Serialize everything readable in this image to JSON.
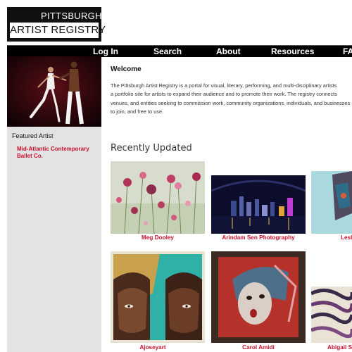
{
  "logo": {
    "line1": "PITTSBURGH",
    "line2": "ARTIST REGISTRY"
  },
  "nav": [
    {
      "label": "Log In"
    },
    {
      "label": "Search"
    },
    {
      "label": "About"
    },
    {
      "label": "Resources"
    },
    {
      "label": "FAQ"
    }
  ],
  "sidebar": {
    "featured_label": "Featured Artist",
    "featured_artist": "Mid-Atlantic Contemporary Ballet Co."
  },
  "welcome": {
    "title": "Welcome",
    "lines": [
      "The Pittsburgh Artist Registry is a portal for visual, literary, performing, and multi-disciplinary artists",
      "a portfolio site for artists to expand their audience and to promote their work. The registry connects",
      "venues, and entities seeking to commission work, community organizations, individuals, and businesses",
      "to join, and free to use."
    ]
  },
  "recent": {
    "title": "Recently Updated",
    "cards": [
      {
        "name": "Meg Dooley"
      },
      {
        "name": "Arindam Sen Photography"
      },
      {
        "name": "Leslie"
      },
      {
        "name": "Ajoseyart"
      },
      {
        "name": "Carol Amidi"
      },
      {
        "name": "Abigail S"
      }
    ]
  }
}
